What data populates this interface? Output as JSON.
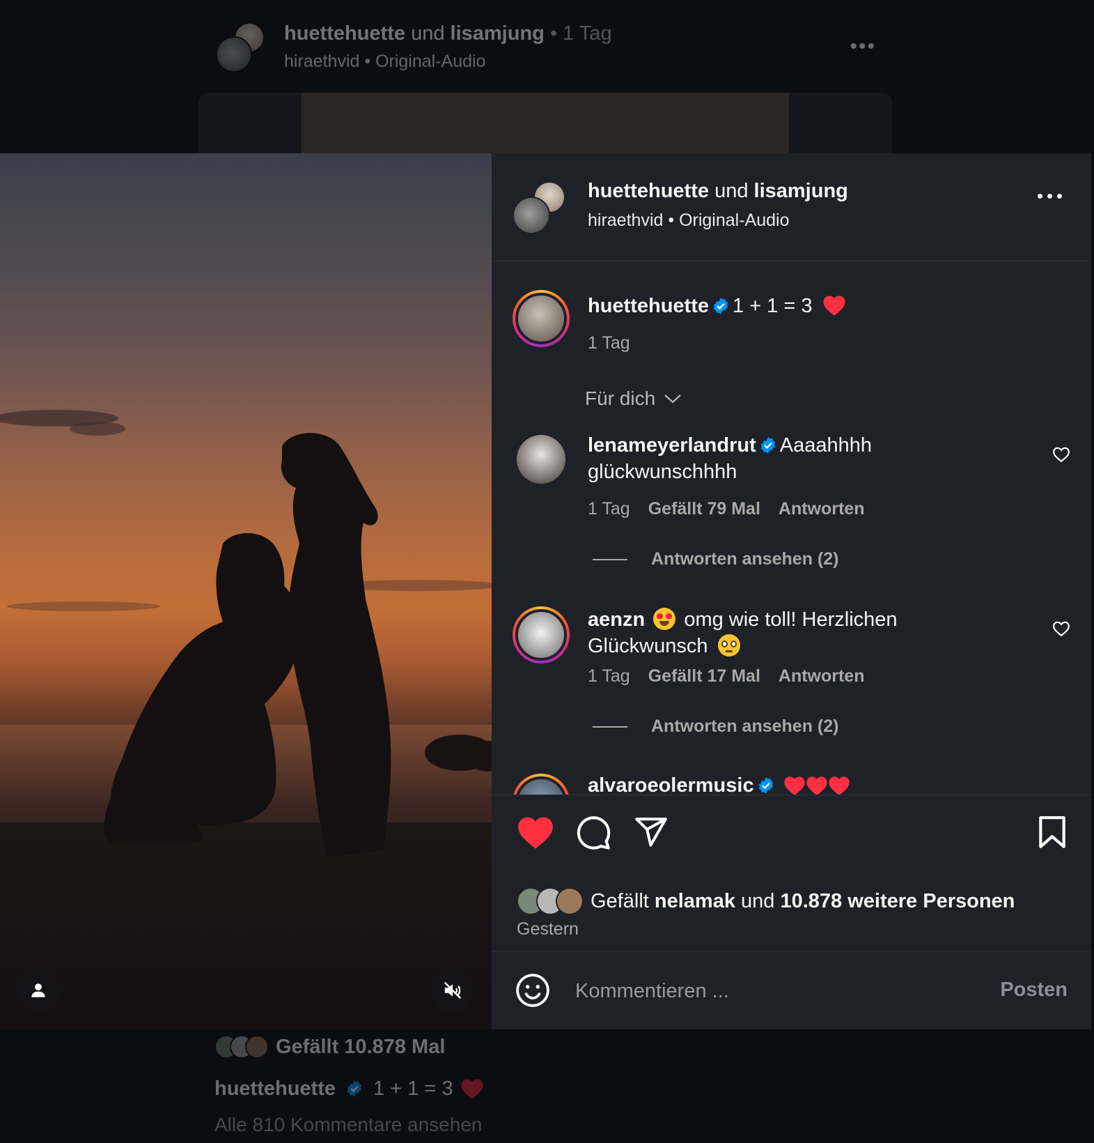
{
  "background": {
    "header": {
      "user1": "huettehuette",
      "joiner": "und",
      "user2": "lisamjung",
      "time": "• 1 Tag",
      "sub_user": "hiraethvid",
      "sub_sep": "•",
      "audio": "Original-Audio"
    },
    "footer": {
      "likes": "Gefällt 10.878 Mal",
      "caption_user": "huettehuette",
      "caption_text": "1 + 1 = 3",
      "all_comments": "Alle 810 Kommentare ansehen"
    }
  },
  "post": {
    "header": {
      "user1": "huettehuette",
      "joiner": "und",
      "user2": "lisamjung",
      "sub_user": "hiraethvid",
      "sub_sep": "•",
      "audio": "Original-Audio"
    },
    "caption": {
      "user": "huettehuette",
      "text": "1 + 1 = 3",
      "time": "1 Tag"
    },
    "filter_label": "Für dich",
    "comments": [
      {
        "user": "lenameyerlandrut",
        "text": "Aaaahhhh glückwunschhhh",
        "time": "1 Tag",
        "likes": "Gefällt 79 Mal",
        "reply": "Antworten",
        "view_replies": "Antworten ansehen (2)"
      },
      {
        "user": "aenzn",
        "text": "omg wie toll! Herzlichen Glückwunsch",
        "time": "1 Tag",
        "likes": "Gefällt 17 Mal",
        "reply": "Antworten",
        "view_replies": "Antworten ansehen (2)"
      },
      {
        "user": "alvaroeolermusic"
      }
    ],
    "likes": {
      "prefix": "Gefällt",
      "user": "nelamak",
      "joiner": "und",
      "others": "10.878 weitere Personen",
      "date": "Gestern"
    },
    "composer": {
      "placeholder": "Kommentieren ...",
      "post_label": "Posten"
    }
  },
  "colors": {
    "like_red": "#ff3040",
    "verified_blue": "#0095f6",
    "panel_bg": "#1f2128",
    "page_bg": "#0b0d11"
  },
  "icons": [
    "more-icon",
    "verified-icon",
    "heart-emoji-icon",
    "chevron-down-icon",
    "heart-outline-icon",
    "heart-filled-icon",
    "comment-icon",
    "share-icon",
    "bookmark-icon",
    "smile-icon",
    "user-icon",
    "mute-icon"
  ]
}
